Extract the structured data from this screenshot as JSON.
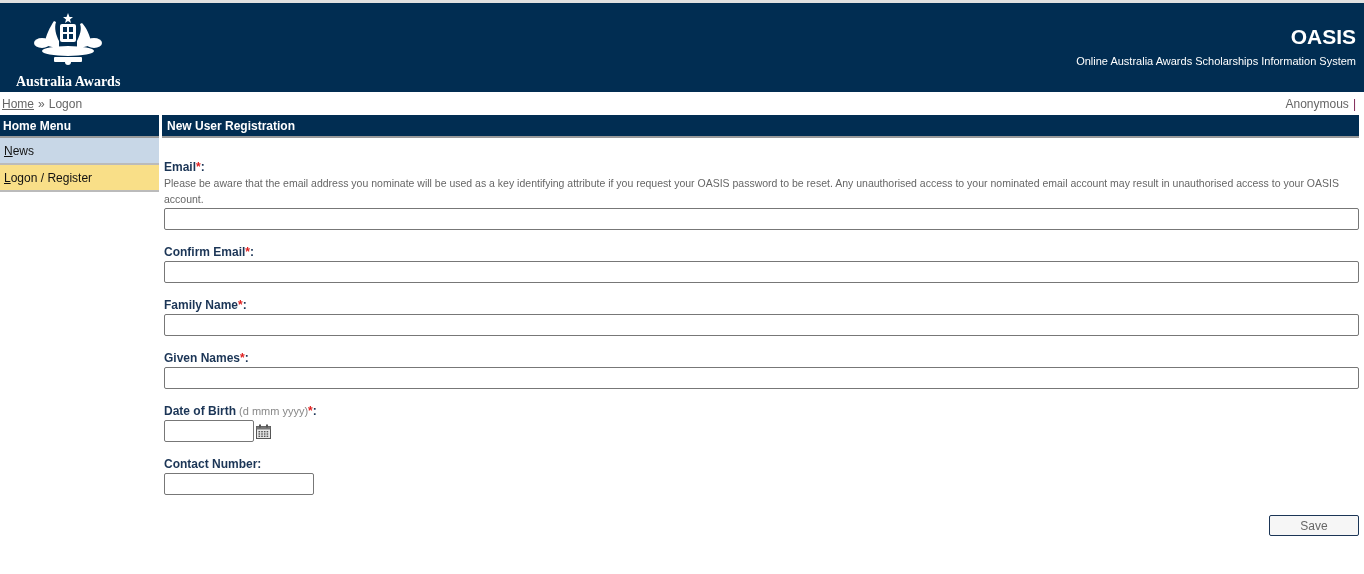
{
  "header": {
    "logo_text": "Australia Awards",
    "title": "OASIS",
    "subtitle": "Online Australia Awards Scholarships Information System"
  },
  "breadcrumb": {
    "items": [
      {
        "label": "Home",
        "link": true
      },
      {
        "label": "Logon",
        "link": false
      }
    ],
    "separator": "»"
  },
  "user": {
    "name": "Anonymous",
    "divider": "|"
  },
  "sidebar": {
    "title": "Home Menu",
    "items": [
      {
        "label": "News",
        "selected": false,
        "access_underline": true
      },
      {
        "label": "Logon / Register",
        "selected": true,
        "access_underline": true
      }
    ]
  },
  "form": {
    "title": "New User Registration",
    "label_suffix": ":",
    "fields": [
      {
        "label": "Email",
        "required_mark": "*",
        "description": "Please be aware that the email address you nominate will be used as a key identifying attribute if you request your OASIS password to be reset. Any unauthorised access to your nominated email account may result in unauthorised access to your OASIS account.",
        "kind": "full"
      },
      {
        "label": "Confirm Email",
        "required_mark": "*",
        "kind": "full"
      },
      {
        "label": "Family Name",
        "required_mark": "*",
        "kind": "full"
      },
      {
        "label": "Given Names",
        "required_mark": "*",
        "kind": "full"
      },
      {
        "label": "Date of Birth",
        "hint": "(d mmm yyyy)",
        "required_mark": "*",
        "kind": "date"
      },
      {
        "label": "Contact Number",
        "kind": "short"
      }
    ],
    "save_button": "Save"
  }
}
